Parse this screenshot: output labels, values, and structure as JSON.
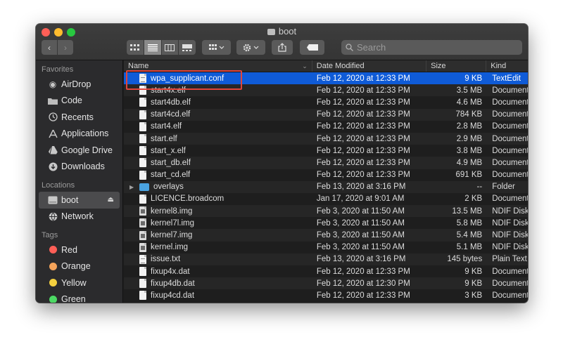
{
  "window": {
    "title": "boot",
    "search_placeholder": "Search"
  },
  "toolbar": {
    "back_icon": "chevron-left-icon",
    "forward_icon": "chevron-right-icon",
    "views": [
      "icon-view",
      "list-view",
      "column-view",
      "gallery-view"
    ],
    "active_view": "list-view"
  },
  "sidebar": {
    "favorites_label": "Favorites",
    "favorites": [
      {
        "label": "AirDrop",
        "icon": "airdrop-icon"
      },
      {
        "label": "Code",
        "icon": "folder-icon"
      },
      {
        "label": "Recents",
        "icon": "clock-icon"
      },
      {
        "label": "Applications",
        "icon": "applications-icon"
      },
      {
        "label": "Google Drive",
        "icon": "google-drive-icon"
      },
      {
        "label": "Downloads",
        "icon": "download-icon"
      }
    ],
    "locations_label": "Locations",
    "locations": [
      {
        "label": "boot",
        "icon": "disk-icon"
      },
      {
        "label": "Network",
        "icon": "globe-icon"
      }
    ],
    "tags_label": "Tags",
    "tags": [
      {
        "label": "Red",
        "color": "#ff5f57"
      },
      {
        "label": "Orange",
        "color": "#f5a35a"
      },
      {
        "label": "Yellow",
        "color": "#f4d03f"
      },
      {
        "label": "Green",
        "color": "#4cd964"
      }
    ]
  },
  "columns": {
    "name": "Name",
    "date": "Date Modified",
    "size": "Size",
    "kind": "Kind"
  },
  "files": [
    {
      "name": "wpa_supplicant.conf",
      "date": "Feb 12, 2020 at 12:33 PM",
      "size": "9 KB",
      "kind": "TextEdit",
      "type": "text"
    },
    {
      "name": "start4x.elf",
      "date": "Feb 12, 2020 at 12:33 PM",
      "size": "3.5 MB",
      "kind": "Document",
      "type": "doc"
    },
    {
      "name": "start4db.elf",
      "date": "Feb 12, 2020 at 12:33 PM",
      "size": "4.6 MB",
      "kind": "Document",
      "type": "doc"
    },
    {
      "name": "start4cd.elf",
      "date": "Feb 12, 2020 at 12:33 PM",
      "size": "784 KB",
      "kind": "Document",
      "type": "doc"
    },
    {
      "name": "start4.elf",
      "date": "Feb 12, 2020 at 12:33 PM",
      "size": "2.8 MB",
      "kind": "Document",
      "type": "doc"
    },
    {
      "name": "start.elf",
      "date": "Feb 12, 2020 at 12:33 PM",
      "size": "2.9 MB",
      "kind": "Document",
      "type": "doc"
    },
    {
      "name": "start_x.elf",
      "date": "Feb 12, 2020 at 12:33 PM",
      "size": "3.8 MB",
      "kind": "Document",
      "type": "doc"
    },
    {
      "name": "start_db.elf",
      "date": "Feb 12, 2020 at 12:33 PM",
      "size": "4.9 MB",
      "kind": "Document",
      "type": "doc"
    },
    {
      "name": "start_cd.elf",
      "date": "Feb 12, 2020 at 12:33 PM",
      "size": "691 KB",
      "kind": "Document",
      "type": "doc"
    },
    {
      "name": "overlays",
      "date": "Feb 13, 2020 at 3:16 PM",
      "size": "--",
      "kind": "Folder",
      "type": "folder"
    },
    {
      "name": "LICENCE.broadcom",
      "date": "Jan 17, 2020 at 9:01 AM",
      "size": "2 KB",
      "kind": "Document",
      "type": "doc"
    },
    {
      "name": "kernel8.img",
      "date": "Feb 3, 2020 at 11:50 AM",
      "size": "13.5 MB",
      "kind": "NDIF Disk",
      "type": "dmg"
    },
    {
      "name": "kernel7l.img",
      "date": "Feb 3, 2020 at 11:50 AM",
      "size": "5.8 MB",
      "kind": "NDIF Disk",
      "type": "dmg"
    },
    {
      "name": "kernel7.img",
      "date": "Feb 3, 2020 at 11:50 AM",
      "size": "5.4 MB",
      "kind": "NDIF Disk",
      "type": "dmg"
    },
    {
      "name": "kernel.img",
      "date": "Feb 3, 2020 at 11:50 AM",
      "size": "5.1 MB",
      "kind": "NDIF Disk",
      "type": "dmg"
    },
    {
      "name": "issue.txt",
      "date": "Feb 13, 2020 at 3:16 PM",
      "size": "145 bytes",
      "kind": "Plain Text",
      "type": "text"
    },
    {
      "name": "fixup4x.dat",
      "date": "Feb 12, 2020 at 12:33 PM",
      "size": "9 KB",
      "kind": "Document",
      "type": "doc"
    },
    {
      "name": "fixup4db.dat",
      "date": "Feb 12, 2020 at 12:30 PM",
      "size": "9 KB",
      "kind": "Document",
      "type": "doc"
    },
    {
      "name": "fixup4cd.dat",
      "date": "Feb 12, 2020 at 12:33 PM",
      "size": "3 KB",
      "kind": "Document",
      "type": "doc"
    }
  ],
  "selected_index": 0
}
